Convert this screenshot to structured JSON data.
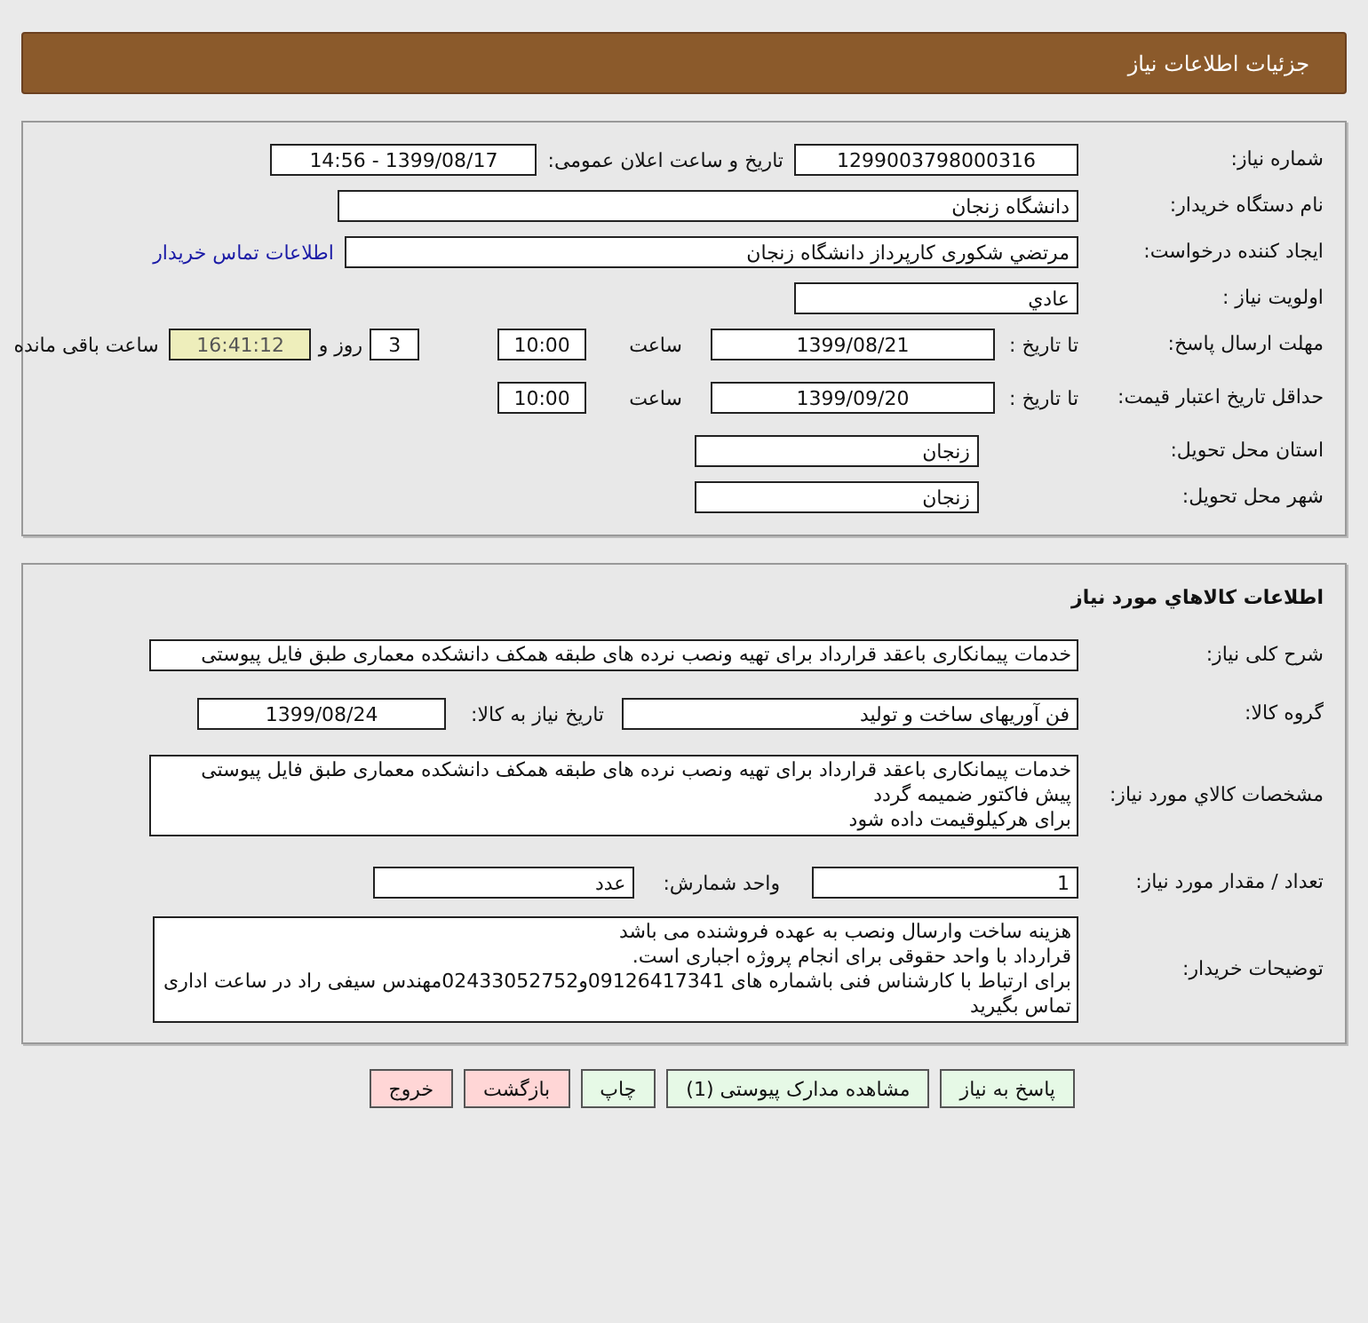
{
  "header": {
    "title": "جزئیات اطلاعات نیاز"
  },
  "details": {
    "need_number": {
      "label": "شماره نیاز:",
      "value": "1299003798000316"
    },
    "announce": {
      "label": "تاریخ و ساعت اعلان عمومی:",
      "value": "1399/08/17 - 14:56"
    },
    "buyer": {
      "label": "نام دستگاه خریدار:",
      "value": "دانشگاه زنجان"
    },
    "creator": {
      "label": "ایجاد کننده درخواست:",
      "value": "مرتضي شکوری کارپرداز دانشگاه زنجان",
      "link": "اطلاعات تماس خریدار"
    },
    "priority": {
      "label": "اولویت نیاز :",
      "value": "عادي"
    },
    "deadline": {
      "label": "مهلت ارسال پاسخ:",
      "to_label": "تا تاریخ :",
      "date": "1399/08/21",
      "time_label": "ساعت",
      "time": "10:00",
      "days": "3",
      "days_label": "روز و",
      "remaining": "16:41:12",
      "remaining_label": "ساعت باقی مانده"
    },
    "validity": {
      "label": "حداقل تاریخ اعتبار قیمت:",
      "to_label": "تا تاریخ :",
      "date": "1399/09/20",
      "time_label": "ساعت",
      "time": "10:00"
    },
    "province": {
      "label": "استان محل تحویل:",
      "value": "زنجان"
    },
    "city": {
      "label": "شهر محل تحویل:",
      "value": "زنجان"
    }
  },
  "goods": {
    "title": "اطلاعات کالاهاي مورد نياز",
    "summary": {
      "label": "شرح کلی نیاز:",
      "value": "خدمات پیمانکاری باعقد قرارداد برای تهیه ونصب نرده های طبقه همکف دانشکده معماری طبق فایل پیوستی"
    },
    "group": {
      "label": "گروه کالا:",
      "value": "فن آوریهای ساخت و تولید",
      "date_label": "تاریخ نیاز به کالا:",
      "date": "1399/08/24"
    },
    "specs": {
      "label": "مشخصات کالاي مورد نياز:",
      "value": "خدمات پیمانکاری باعقد قرارداد برای تهیه ونصب نرده های طبقه همکف دانشکده معماری طبق فایل پیوستی\nپیش فاکتور ضمیمه گردد\nبرای هرکیلوقیمت داده شود"
    },
    "quantity": {
      "label": "تعداد / مقدار مورد نیاز:",
      "value": "1",
      "unit_label": "واحد شمارش:",
      "unit": "عدد"
    },
    "notes": {
      "label": "توضیحات خریدار:",
      "value": "هزینه ساخت وارسال ونصب به عهده فروشنده می باشد\nقرارداد با واحد حقوقی برای انجام پروژه اجباری است.\nبرای ارتباط با کارشناس فنی باشماره های 09126417341و02433052752مهندس سیفی راد در ساعت اداری تماس بگیرید"
    }
  },
  "buttons": [
    {
      "label": "پاسخ به نیاز",
      "color": "#e6f9e6"
    },
    {
      "label": "مشاهده مدارک پیوستی (1)",
      "color": "#e6f9e6"
    },
    {
      "label": "چاپ",
      "color": "#e6f9e6"
    },
    {
      "label": "بازگشت",
      "color": "#ffd6d6"
    },
    {
      "label": "خروج",
      "color": "#ffd6d6"
    }
  ]
}
